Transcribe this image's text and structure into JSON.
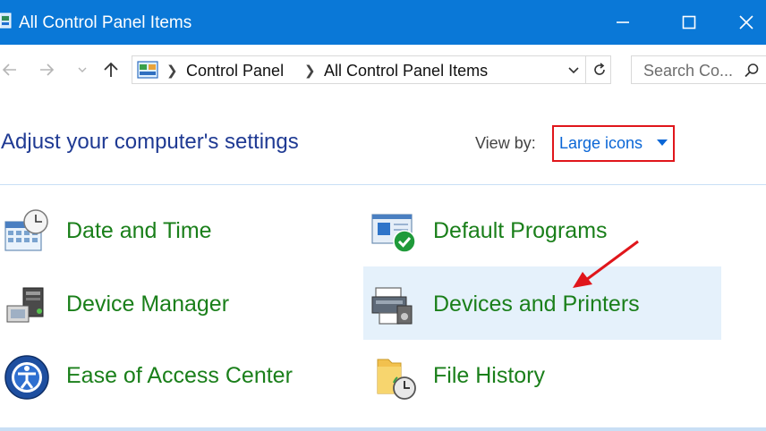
{
  "window": {
    "title": "All Control Panel Items",
    "minimize_icon": "minimize-icon",
    "maximize_icon": "maximize-icon",
    "close_icon": "close-icon",
    "accent": "#0a78d7"
  },
  "navigation": {
    "back_icon": "arrow-left-icon",
    "forward_icon": "arrow-right-icon",
    "recent_icon": "chevron-down-icon",
    "up_icon": "arrow-up-icon"
  },
  "address_bar": {
    "breadcrumbs": [
      "Control Panel",
      "All Control Panel Items"
    ],
    "dropdown_icon": "chevron-down-icon",
    "refresh_icon": "refresh-icon"
  },
  "search": {
    "placeholder": "Search Co...",
    "icon": "search-icon"
  },
  "header": {
    "title": "Adjust your computer's settings",
    "view_by_label": "View by:",
    "view_by_value": "Large icons",
    "highlight_color": "#e0161b"
  },
  "items": [
    {
      "label": "Date and Time",
      "icon": "calendar-clock-icon"
    },
    {
      "label": "Default Programs",
      "icon": "default-programs-icon"
    },
    {
      "label": "Device Manager",
      "icon": "device-manager-icon"
    },
    {
      "label": "Devices and Printers",
      "icon": "printer-icon",
      "selected": true
    },
    {
      "label": "Ease of Access Center",
      "icon": "ease-of-access-icon"
    },
    {
      "label": "File History",
      "icon": "folder-clock-icon"
    }
  ],
  "annotation": {
    "type": "red-arrow",
    "target": "Devices and Printers",
    "color": "#e0161b"
  }
}
